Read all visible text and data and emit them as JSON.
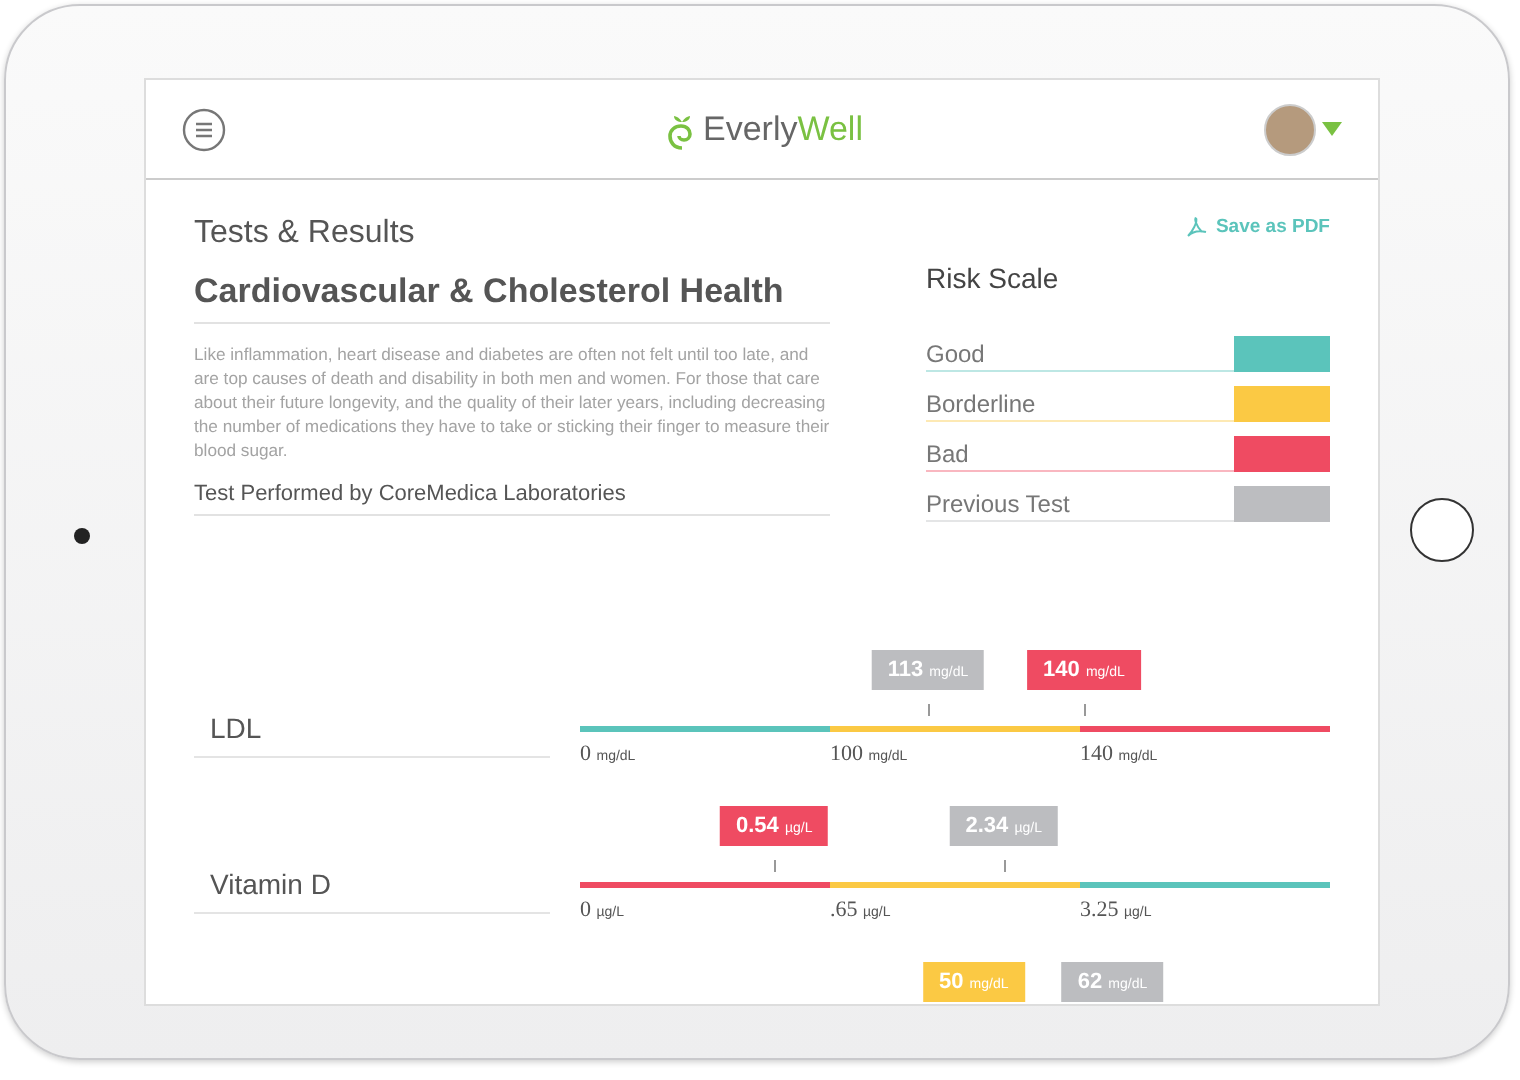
{
  "header": {
    "brand": [
      "Everly",
      "Well"
    ]
  },
  "section_title": "Tests & Results",
  "save_link": "Save as PDF",
  "test_title": "Cardiovascular & Cholesterol Health",
  "description": "Like inflammation, heart disease and diabetes are often not felt until too late, and are top causes of death and disability in both men and women. For those that care about their future longevity, and the quality of their later years, including decreasing the number of medications they have to take or sticking their finger to measure their blood sugar.",
  "performed_by": "Test Performed by CoreMedica Laboratories",
  "risk_scale": {
    "title": "Risk Scale",
    "items": [
      {
        "label": "Good",
        "color": "#5bc4bb"
      },
      {
        "label": "Borderline",
        "color": "#fbc944"
      },
      {
        "label": "Bad",
        "color": "#ef4b62"
      },
      {
        "label": "Previous Test",
        "color": "#bcbdc0"
      }
    ]
  },
  "results": [
    {
      "name": "LDL",
      "segments": [
        {
          "kind": "good"
        },
        {
          "kind": "borderline"
        },
        {
          "kind": "bad"
        }
      ],
      "ticks": [
        {
          "value": "0",
          "unit": "mg/dL"
        },
        {
          "value": "100",
          "unit": "mg/dL"
        },
        {
          "value": "140",
          "unit": "mg/dL"
        }
      ],
      "markers": [
        {
          "value": "113",
          "unit": "mg/dL",
          "kind": "previous",
          "level": 0.464
        },
        {
          "value": "140",
          "unit": "mg/dL",
          "kind": "bad",
          "level": 0.672
        }
      ]
    },
    {
      "name": "Vitamin D",
      "segments": [
        {
          "kind": "bad"
        },
        {
          "kind": "borderline"
        },
        {
          "kind": "good"
        }
      ],
      "ticks": [
        {
          "value": "0",
          "unit": "µg/L"
        },
        {
          "value": ".65",
          "unit": "µg/L"
        },
        {
          "value": "3.25",
          "unit": "µg/L"
        }
      ],
      "markers": [
        {
          "value": "0.54",
          "unit": "µg/L",
          "kind": "bad",
          "level": 0.259
        },
        {
          "value": "2.34",
          "unit": "µg/L",
          "kind": "previous",
          "level": 0.565
        }
      ]
    },
    {
      "markers": [
        {
          "value": "50",
          "unit": "mg/dL",
          "kind": "borderline",
          "level": 0.525
        },
        {
          "value": "62",
          "unit": "mg/dL",
          "kind": "previous",
          "level": 0.71
        }
      ]
    }
  ]
}
